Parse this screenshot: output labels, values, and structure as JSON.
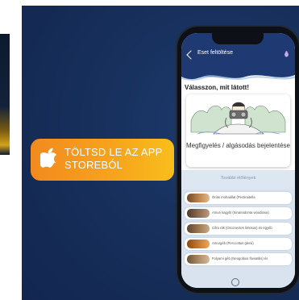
{
  "cta": {
    "label": "TÖLTSD LE AZ APP STOREBÓL"
  },
  "app": {
    "title": "Eset feltöltése",
    "prompt": "Válasszon, mit látott!",
    "observation_card": {
      "label": "Megfigyelés / algásodás bejelentése"
    },
    "section_title": "További élőlények",
    "species": [
      {
        "label": "Óriás moha­állat (Pectinatella",
        "thumb_color": "#b9824a"
      },
      {
        "label": "Amuri kagyló (Sinanodonta woodiana)",
        "thumb_color": "#8a6a52"
      },
      {
        "label": "Cifra rák (Orconectes limosus) és egyéb",
        "thumb_color": "#9a7650"
      },
      {
        "label": "Amurgéb (Perccottus glenii)",
        "thumb_color": "#c9782a"
      },
      {
        "label": "Folyami géb (Neogobius fluviatilis) és",
        "thumb_color": "#a78b68"
      }
    ]
  },
  "colors": {
    "banner_bg": "#17305c",
    "appbar": "#1f3a73",
    "cta_start": "#f28a1e",
    "cta_end": "#f8be1b",
    "list_bg": "#d8e3ef"
  },
  "icons": {
    "store": "apple-icon",
    "back": "chevron-left-icon",
    "action": "bug-icon",
    "home": "home-indicator"
  }
}
